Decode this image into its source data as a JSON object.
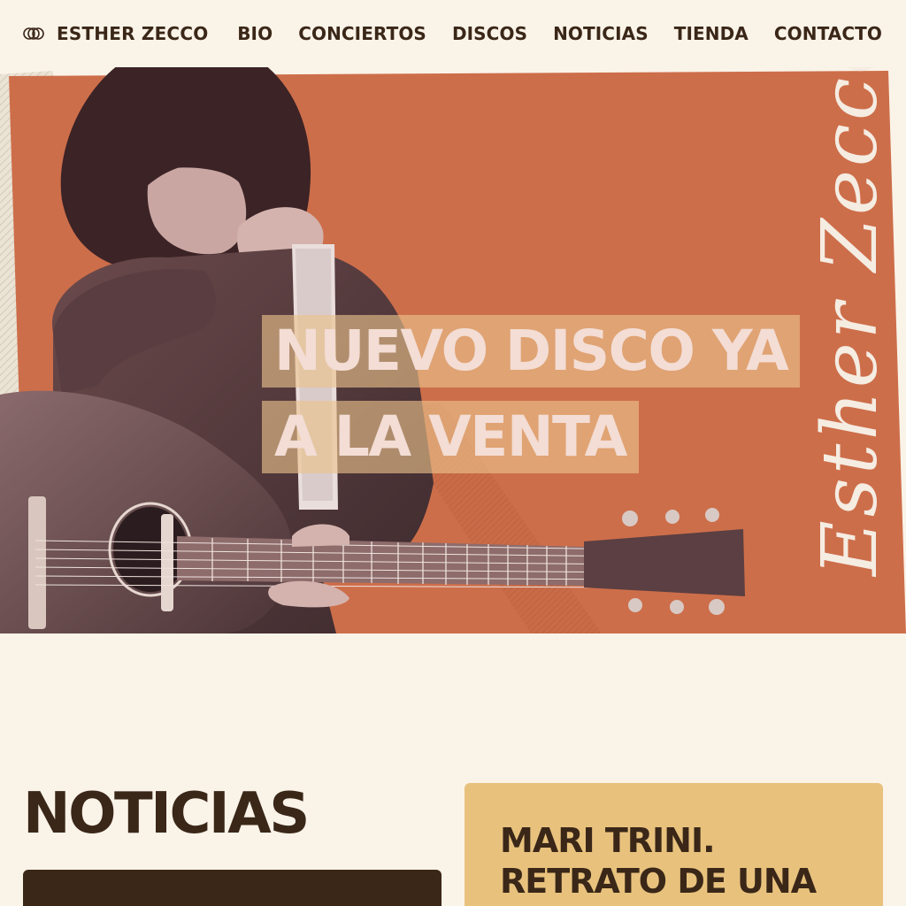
{
  "brand": {
    "name": "ESTHER ZECCO",
    "logo_icon": "three-rings-icon"
  },
  "nav": {
    "items": [
      "BIO",
      "CONCIERTOS",
      "DISCOS",
      "NOTICIAS",
      "TIENDA",
      "CONTACTO"
    ]
  },
  "hero": {
    "headline_line1": "NUEVO DISCO YA",
    "headline_line2": "A LA VENTA",
    "signature_text": "Esther Zecco"
  },
  "news": {
    "title": "NOTICIAS",
    "featured_title": "MARI TRINI. RETRATO DE UNA MUJER LIBRE"
  },
  "colors": {
    "background": "#faf3e8",
    "text": "#3a2718",
    "hero_orange": "#cd6e4a",
    "headline_highlight": "#ecc48c",
    "card_gold": "#e8c27d",
    "card_dark": "#3a2718"
  }
}
